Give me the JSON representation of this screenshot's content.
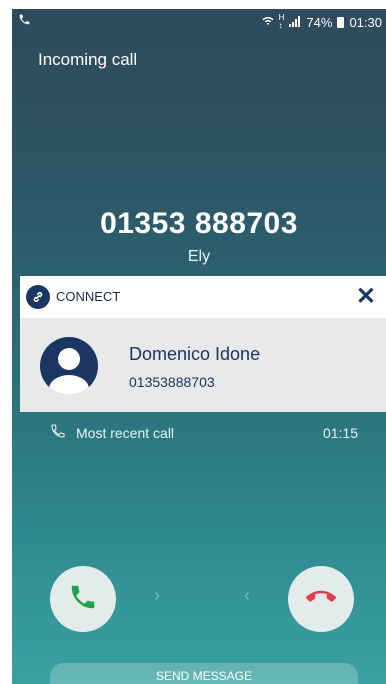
{
  "status_bar": {
    "battery": "74%",
    "time": "01:30"
  },
  "incoming_label": "Incoming call",
  "caller": {
    "number": "01353 888703",
    "location": "Ely"
  },
  "connect_card": {
    "title": "CONNECT",
    "close_symbol": "✕",
    "contact_name": "Domenico Idone",
    "contact_number": "01353888703",
    "colors": {
      "brand": "#1a3661",
      "card_bg": "#e8e9ea"
    }
  },
  "recent_call": {
    "label": "Most recent call",
    "time": "01:15"
  },
  "actions": {
    "answer_icon": "phone-answer-icon",
    "decline_icon": "phone-decline-icon",
    "send_message_label": "SEND MESSAGE"
  },
  "colors": {
    "answer": "#1fa34a",
    "decline": "#e2414c"
  }
}
